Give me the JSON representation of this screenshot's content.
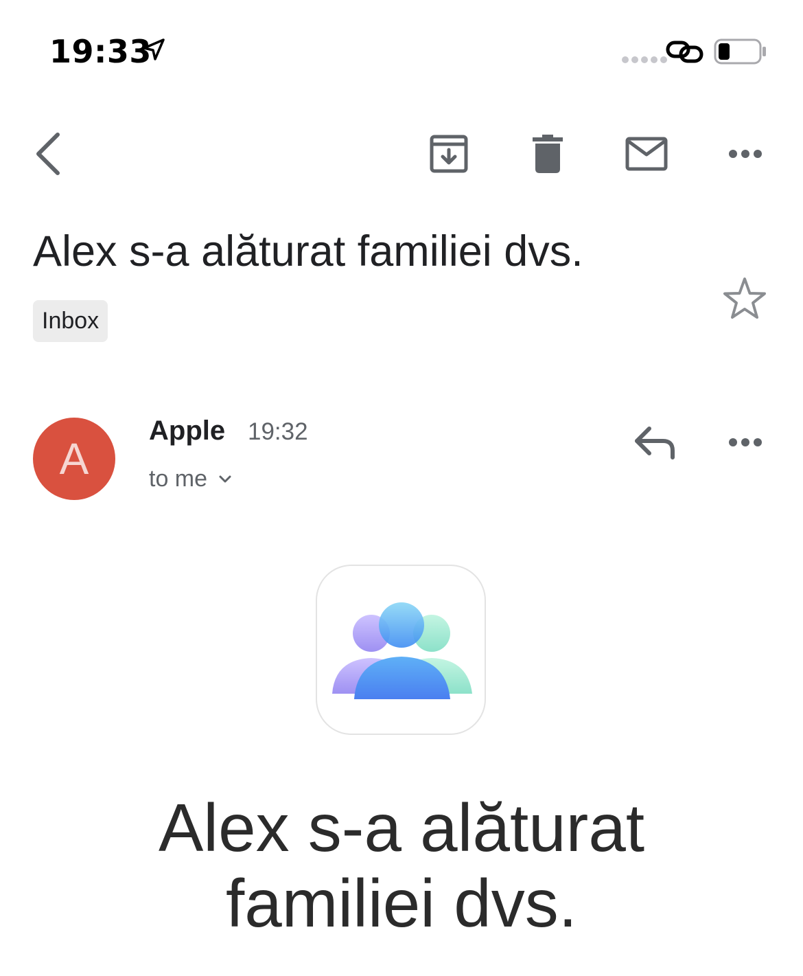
{
  "status_bar": {
    "time": "19:33"
  },
  "toolbar": {
    "icons": [
      "back-arrow",
      "archive",
      "trash",
      "mail",
      "more"
    ]
  },
  "email": {
    "subject": "Alex s-a alăturat familiei dvs.",
    "label": "Inbox",
    "sender_initial": "A",
    "sender_name": "Apple",
    "sent_time": "19:32",
    "recipient": "to me",
    "avatar_color": "#d9513f",
    "body_heading_line1": "Alex s-a alăturat",
    "body_heading_line2": "familiei dvs."
  }
}
